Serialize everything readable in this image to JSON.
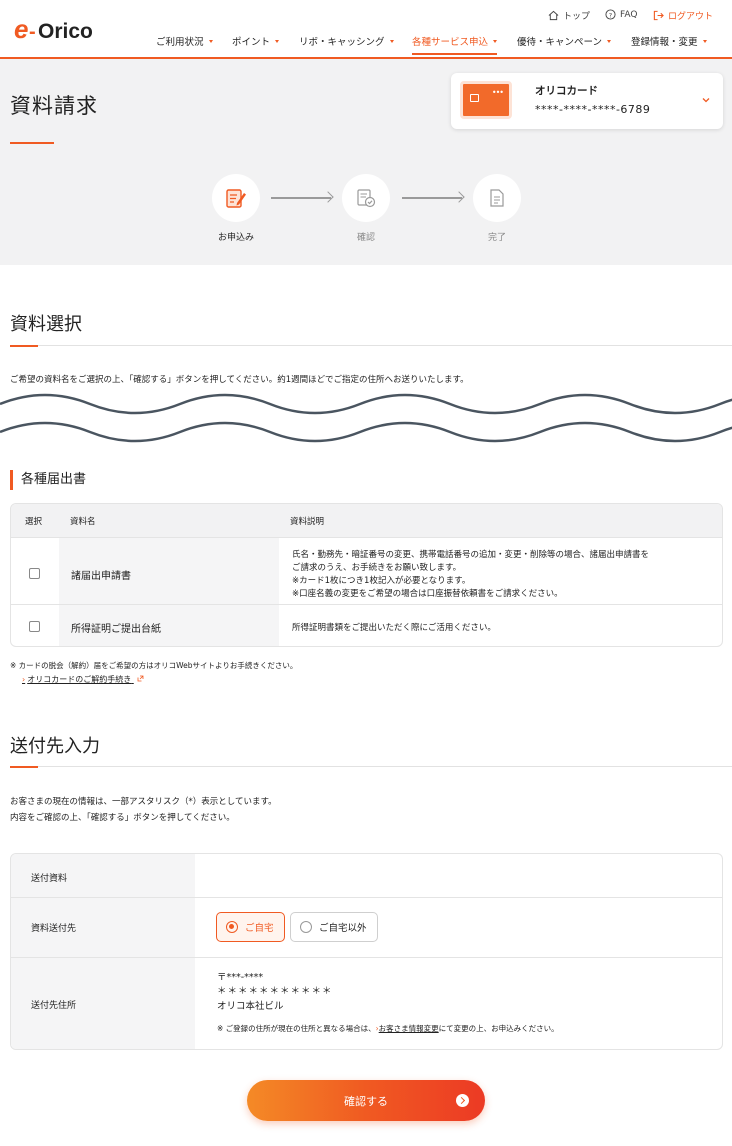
{
  "header": {
    "logo_text": "e-Orico",
    "util_links": [
      {
        "label": "トップ",
        "icon": "home-icon"
      },
      {
        "label": "FAQ",
        "icon": "question-icon"
      },
      {
        "label": "ログアウト",
        "icon": "logout-icon"
      }
    ],
    "nav": [
      {
        "label": "ご利用状況"
      },
      {
        "label": "ポイント"
      },
      {
        "label": "リボ・キャッシング"
      },
      {
        "label": "各種サービス申込",
        "active": true
      },
      {
        "label": "優待・キャンペーン"
      },
      {
        "label": "登録情報・変更"
      }
    ],
    "accent_color": "#f05a22"
  },
  "hero": {
    "title": "資料請求",
    "card": {
      "name": "オリコカード",
      "number": "****-****-****-6789",
      "card_color": "#f26a2a"
    },
    "steps": [
      {
        "label": "お申込み",
        "icon": "form-pen-icon",
        "state": "current"
      },
      {
        "label": "確認",
        "icon": "doc-check-icon",
        "state": "pending"
      },
      {
        "label": "完了",
        "icon": "doc-icon",
        "state": "pending"
      }
    ]
  },
  "selection": {
    "title": "資料選択",
    "intro": "ご希望の資料名をご選択の上、「確認する」ボタンを押してください。約1週間ほどでご指定の住所へお送りいたします。",
    "group_title": "各種届出書",
    "table": {
      "headers": [
        "選択",
        "資料名",
        "資料説明"
      ],
      "rows": [
        {
          "name": "諸届出申請書",
          "checked": false,
          "desc": [
            "氏名・勤務先・暗証番号の変更、携帯電話番号の追加・変更・削除等の場合、諸届出申請書を",
            "ご請求のうえ、お手続きをお願い致します。",
            "※カード1枚につき1枚記入が必要となります。",
            "※口座名義の変更をご希望の場合は口座振替依頼書をご請求ください。"
          ]
        },
        {
          "name": "所得証明ご提出台紙",
          "checked": false,
          "desc": [
            "所得証明書類をご提出いただく際にご活用ください。"
          ]
        }
      ]
    },
    "note": "※ カードの脱会（解約）届をご希望の方はオリコWebサイトよりお手続きください。",
    "link": "オリコカードのご解約手続き"
  },
  "delivery": {
    "title": "送付先入力",
    "intro_1": "お客さまの現在の情報は、一部アスタリスク（*）表示としています。",
    "intro_2": "内容をご確認の上、「確認する」ボタンを押してください。",
    "fields": {
      "docs_label": "送付資料",
      "docs_value": "",
      "dest_label": "資料送付先",
      "options": [
        {
          "label": "ご自宅",
          "selected": true
        },
        {
          "label": "ご自宅以外",
          "selected": false
        }
      ],
      "addr_label": "送付先住所",
      "postal": "〒***-****",
      "addr_masked": "＊＊＊＊＊＊＊＊＊＊＊",
      "building": "オリコ本社ビル",
      "addr_note_pre": "※ ご登録の住所が現在の住所と異なる場合は、",
      "addr_note_link": "お客さま情報変更",
      "addr_note_post": "にて変更の上、お申込みください。"
    }
  },
  "confirm_button": "確認する"
}
